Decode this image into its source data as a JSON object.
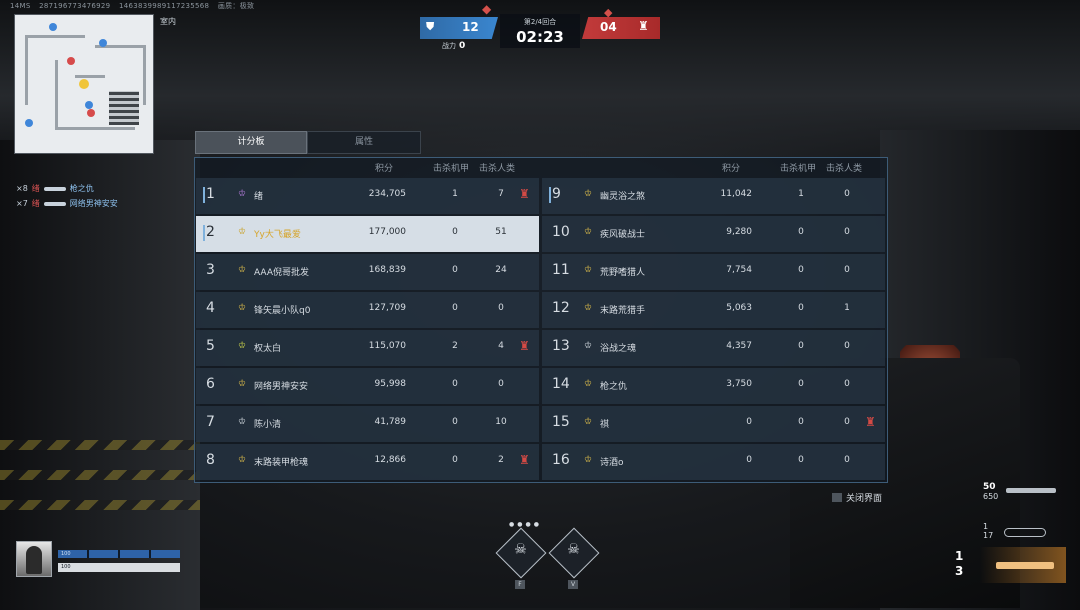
{
  "stats": {
    "latency": "14MS",
    "id1": "287196773476929",
    "id2": "1463839989117235568",
    "extra": "画质：极致"
  },
  "minimap": {
    "label": "室内"
  },
  "killfeed": [
    {
      "icon": "×8",
      "killer": "绪",
      "victim": "枪之仇"
    },
    {
      "icon": "×7",
      "killer": "绪",
      "victim": "网络男神安安"
    }
  ],
  "hud": {
    "blue_score": "12",
    "red_score": "04",
    "round_label": "第2/4回合",
    "timer": "02:23",
    "power_label": "战力",
    "power_value": "0"
  },
  "tabs": {
    "scoreboard": "计分板",
    "attributes": "属性"
  },
  "headers": {
    "score": "积分",
    "kill_mech": "击杀机甲",
    "kill_human": "击杀人类"
  },
  "left_rows": [
    {
      "rank": "1",
      "name": "绪",
      "score": "234,705",
      "kmech": "1",
      "khuman": "7",
      "mech": true,
      "badge_color": "#b07ad6"
    },
    {
      "rank": "2",
      "name": "Yy大飞最爱",
      "score": "177,000",
      "kmech": "0",
      "khuman": "51",
      "mech": false,
      "badge_color": "#c9a227",
      "highlight": true
    },
    {
      "rank": "3",
      "name": "AAA倪哥批发",
      "score": "168,839",
      "kmech": "0",
      "khuman": "24",
      "mech": false,
      "badge_color": "#d7b84a"
    },
    {
      "rank": "4",
      "name": "锋矢晨小队q0",
      "score": "127,709",
      "kmech": "0",
      "khuman": "0",
      "mech": false,
      "badge_color": "#d7b84a"
    },
    {
      "rank": "5",
      "name": "权太白",
      "score": "115,070",
      "kmech": "2",
      "khuman": "4",
      "mech": true,
      "badge_color": "#c9d14a"
    },
    {
      "rank": "6",
      "name": "网络男神安安",
      "score": "95,998",
      "kmech": "0",
      "khuman": "0",
      "mech": false,
      "badge_color": "#d7b84a"
    },
    {
      "rank": "7",
      "name": "陈小清",
      "score": "41,789",
      "kmech": "0",
      "khuman": "10",
      "mech": false,
      "badge_color": "#cfd6dc"
    },
    {
      "rank": "8",
      "name": "末路装甲枪魂",
      "score": "12,866",
      "kmech": "0",
      "khuman": "2",
      "mech": true,
      "badge_color": "#d7b84a"
    }
  ],
  "right_rows": [
    {
      "rank": "9",
      "name": "幽灵浴之煞",
      "score": "11,042",
      "kmech": "1",
      "khuman": "0",
      "mech": false,
      "badge_color": "#d7b84a"
    },
    {
      "rank": "10",
      "name": "疾风破战士",
      "score": "9,280",
      "kmech": "0",
      "khuman": "0",
      "mech": false,
      "badge_color": "#d7b84a"
    },
    {
      "rank": "11",
      "name": "荒野嗜猎人",
      "score": "7,754",
      "kmech": "0",
      "khuman": "0",
      "mech": false,
      "badge_color": "#d7b84a"
    },
    {
      "rank": "12",
      "name": "末路荒猎手",
      "score": "5,063",
      "kmech": "0",
      "khuman": "1",
      "mech": false,
      "badge_color": "#d7b84a"
    },
    {
      "rank": "13",
      "name": "浴战之魂",
      "score": "4,357",
      "kmech": "0",
      "khuman": "0",
      "mech": false,
      "badge_color": "#cfd6dc"
    },
    {
      "rank": "14",
      "name": "枪之仇",
      "score": "3,750",
      "kmech": "0",
      "khuman": "0",
      "mech": false,
      "badge_color": "#d7b84a"
    },
    {
      "rank": "15",
      "name": "祺",
      "score": "0",
      "kmech": "0",
      "khuman": "0",
      "mech": true,
      "badge_color": "#d7b84a"
    },
    {
      "rank": "16",
      "name": "诗酒o",
      "score": "0",
      "kmech": "0",
      "khuman": "0",
      "mech": false,
      "badge_color": "#d7b84a"
    }
  ],
  "close": {
    "label": "关闭界面"
  },
  "weapons": {
    "primary_ammo": "50",
    "primary_reserve": "650",
    "secondary_slot": "1",
    "secondary_ammo": "17",
    "active_slot": "1",
    "active_count": "3"
  },
  "skills": {
    "key_left": "F",
    "key_right": "V"
  },
  "player": {
    "armor": "100",
    "health": "100"
  },
  "colors": {
    "blue_team": "#3a86cf",
    "red_team": "#c23b3b",
    "mech_red": "#d34a45",
    "accent_gold": "#d6a52c"
  }
}
